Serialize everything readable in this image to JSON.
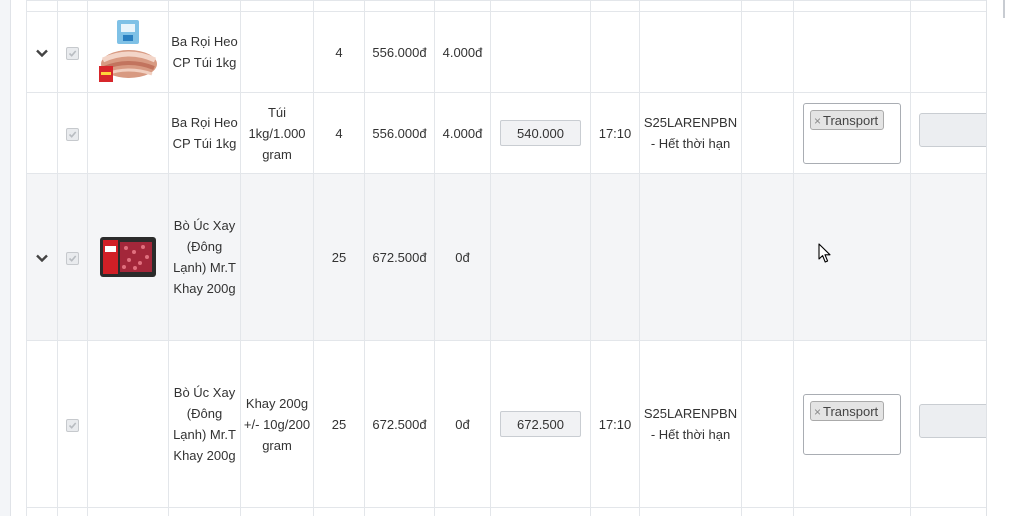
{
  "rows": [
    {
      "type": "parent",
      "expand_icon": "chevron-down-icon",
      "image": "pork-belly-product",
      "name": "Ba Rọi Heo CP Túi 1kg",
      "qty": "4",
      "amount": "556.000đ",
      "discount": "4.000đ"
    },
    {
      "type": "child",
      "name": "Ba Rọi Heo CP Túi 1kg",
      "unit": "Túi 1kg/1.000 gram",
      "qty": "4",
      "amount": "556.000đ",
      "discount": "4.000đ",
      "price": "540.000",
      "time": "17:10",
      "promo": "S25LARENPBN - Hết thời hạn",
      "tag": "Transport",
      "tag_remove": "×"
    },
    {
      "type": "parent",
      "expand_icon": "chevron-down-icon",
      "image": "ground-beef-product",
      "name": "Bò Úc Xay (Đông Lạnh) Mr.T Khay 200g",
      "qty": "25",
      "amount": "672.500đ",
      "discount": "0đ"
    },
    {
      "type": "child",
      "name": "Bò Úc Xay (Đông Lạnh) Mr.T Khay 200g",
      "unit": "Khay 200g +/- 10g/200 gram",
      "qty": "25",
      "amount": "672.500đ",
      "discount": "0đ",
      "price": "672.500",
      "time": "17:10",
      "promo": "S25LARENPBN - Hết thời hạn",
      "tag": "Transport",
      "tag_remove": "×"
    }
  ],
  "colors": {
    "accent_row": "#f4f5f7",
    "border": "#e3e6ea",
    "chip_bg": "#e4e4e4"
  }
}
